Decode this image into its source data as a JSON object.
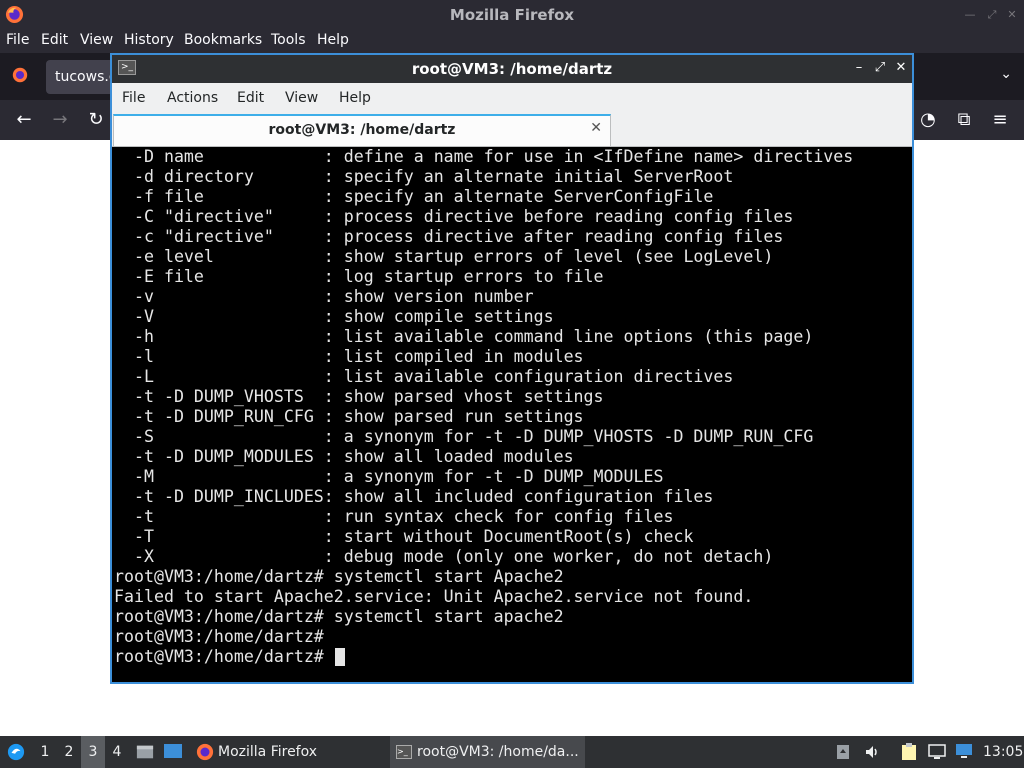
{
  "firefox": {
    "title": "Mozilla Firefox",
    "menu": [
      "File",
      "Edit",
      "View",
      "History",
      "Bookmarks",
      "Tools",
      "Help"
    ],
    "tab_label": "tucows.co"
  },
  "terminal": {
    "title": "root@VM3: /home/dartz",
    "menu": [
      "File",
      "Actions",
      "Edit",
      "View",
      "Help"
    ],
    "tab_label": "root@VM3: /home/dartz",
    "lines": [
      "  -D name            : define a name for use in <IfDefine name> directives",
      "  -d directory       : specify an alternate initial ServerRoot",
      "  -f file            : specify an alternate ServerConfigFile",
      "  -C \"directive\"     : process directive before reading config files",
      "  -c \"directive\"     : process directive after reading config files",
      "  -e level           : show startup errors of level (see LogLevel)",
      "  -E file            : log startup errors to file",
      "  -v                 : show version number",
      "  -V                 : show compile settings",
      "  -h                 : list available command line options (this page)",
      "  -l                 : list compiled in modules",
      "  -L                 : list available configuration directives",
      "  -t -D DUMP_VHOSTS  : show parsed vhost settings",
      "  -t -D DUMP_RUN_CFG : show parsed run settings",
      "  -S                 : a synonym for -t -D DUMP_VHOSTS -D DUMP_RUN_CFG",
      "  -t -D DUMP_MODULES : show all loaded modules",
      "  -M                 : a synonym for -t -D DUMP_MODULES",
      "  -t -D DUMP_INCLUDES: show all included configuration files",
      "  -t                 : run syntax check for config files",
      "  -T                 : start without DocumentRoot(s) check",
      "  -X                 : debug mode (only one worker, do not detach)",
      "root@VM3:/home/dartz# systemctl start Apache2",
      "Failed to start Apache2.service: Unit Apache2.service not found.",
      "root@VM3:/home/dartz# systemctl start apache2",
      "root@VM3:/home/dartz#",
      "root@VM3:/home/dartz# "
    ]
  },
  "taskbar": {
    "workspaces": [
      "1",
      "2",
      "3",
      "4"
    ],
    "active_workspace": "3",
    "apps": [
      {
        "label": "Mozilla Firefox",
        "icon": "firefox-icon"
      },
      {
        "label": "root@VM3: /home/da...",
        "icon": "terminal-icon"
      }
    ],
    "clock": "13:05"
  },
  "colors": {
    "firefox_dark": "#2b2a33",
    "terminal_border": "#3c8fd9",
    "taskbar_bg": "#2e3033"
  }
}
